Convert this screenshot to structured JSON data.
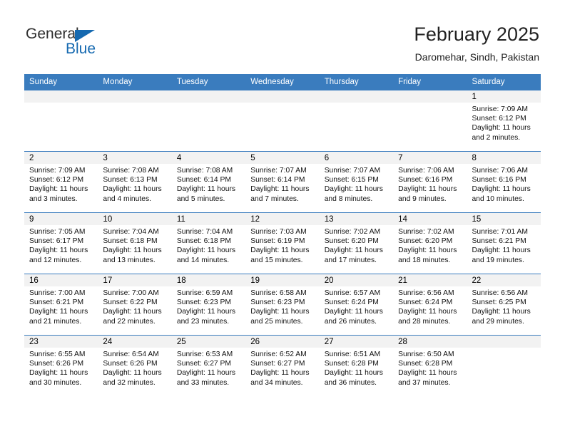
{
  "brand": {
    "name_part1": "General",
    "name_part2": "Blue",
    "triangle_icon": "triangle-icon",
    "accent_color": "#1569b0"
  },
  "header": {
    "title": "February 2025",
    "subtitle": "Daromehar, Sindh, Pakistan"
  },
  "theme": {
    "header_row_color": "#3a7cbe",
    "day_strip_color": "#f2f2f2",
    "grid_line_color": "#3a7cbe"
  },
  "weekday_headers": [
    "Sunday",
    "Monday",
    "Tuesday",
    "Wednesday",
    "Thursday",
    "Friday",
    "Saturday"
  ],
  "weeks": [
    [
      {
        "day": "",
        "sunrise": "",
        "sunset": "",
        "daylight": ""
      },
      {
        "day": "",
        "sunrise": "",
        "sunset": "",
        "daylight": ""
      },
      {
        "day": "",
        "sunrise": "",
        "sunset": "",
        "daylight": ""
      },
      {
        "day": "",
        "sunrise": "",
        "sunset": "",
        "daylight": ""
      },
      {
        "day": "",
        "sunrise": "",
        "sunset": "",
        "daylight": ""
      },
      {
        "day": "",
        "sunrise": "",
        "sunset": "",
        "daylight": ""
      },
      {
        "day": "1",
        "sunrise": "Sunrise: 7:09 AM",
        "sunset": "Sunset: 6:12 PM",
        "daylight": "Daylight: 11 hours and 2 minutes."
      }
    ],
    [
      {
        "day": "2",
        "sunrise": "Sunrise: 7:09 AM",
        "sunset": "Sunset: 6:12 PM",
        "daylight": "Daylight: 11 hours and 3 minutes."
      },
      {
        "day": "3",
        "sunrise": "Sunrise: 7:08 AM",
        "sunset": "Sunset: 6:13 PM",
        "daylight": "Daylight: 11 hours and 4 minutes."
      },
      {
        "day": "4",
        "sunrise": "Sunrise: 7:08 AM",
        "sunset": "Sunset: 6:14 PM",
        "daylight": "Daylight: 11 hours and 5 minutes."
      },
      {
        "day": "5",
        "sunrise": "Sunrise: 7:07 AM",
        "sunset": "Sunset: 6:14 PM",
        "daylight": "Daylight: 11 hours and 7 minutes."
      },
      {
        "day": "6",
        "sunrise": "Sunrise: 7:07 AM",
        "sunset": "Sunset: 6:15 PM",
        "daylight": "Daylight: 11 hours and 8 minutes."
      },
      {
        "day": "7",
        "sunrise": "Sunrise: 7:06 AM",
        "sunset": "Sunset: 6:16 PM",
        "daylight": "Daylight: 11 hours and 9 minutes."
      },
      {
        "day": "8",
        "sunrise": "Sunrise: 7:06 AM",
        "sunset": "Sunset: 6:16 PM",
        "daylight": "Daylight: 11 hours and 10 minutes."
      }
    ],
    [
      {
        "day": "9",
        "sunrise": "Sunrise: 7:05 AM",
        "sunset": "Sunset: 6:17 PM",
        "daylight": "Daylight: 11 hours and 12 minutes."
      },
      {
        "day": "10",
        "sunrise": "Sunrise: 7:04 AM",
        "sunset": "Sunset: 6:18 PM",
        "daylight": "Daylight: 11 hours and 13 minutes."
      },
      {
        "day": "11",
        "sunrise": "Sunrise: 7:04 AM",
        "sunset": "Sunset: 6:18 PM",
        "daylight": "Daylight: 11 hours and 14 minutes."
      },
      {
        "day": "12",
        "sunrise": "Sunrise: 7:03 AM",
        "sunset": "Sunset: 6:19 PM",
        "daylight": "Daylight: 11 hours and 15 minutes."
      },
      {
        "day": "13",
        "sunrise": "Sunrise: 7:02 AM",
        "sunset": "Sunset: 6:20 PM",
        "daylight": "Daylight: 11 hours and 17 minutes."
      },
      {
        "day": "14",
        "sunrise": "Sunrise: 7:02 AM",
        "sunset": "Sunset: 6:20 PM",
        "daylight": "Daylight: 11 hours and 18 minutes."
      },
      {
        "day": "15",
        "sunrise": "Sunrise: 7:01 AM",
        "sunset": "Sunset: 6:21 PM",
        "daylight": "Daylight: 11 hours and 19 minutes."
      }
    ],
    [
      {
        "day": "16",
        "sunrise": "Sunrise: 7:00 AM",
        "sunset": "Sunset: 6:21 PM",
        "daylight": "Daylight: 11 hours and 21 minutes."
      },
      {
        "day": "17",
        "sunrise": "Sunrise: 7:00 AM",
        "sunset": "Sunset: 6:22 PM",
        "daylight": "Daylight: 11 hours and 22 minutes."
      },
      {
        "day": "18",
        "sunrise": "Sunrise: 6:59 AM",
        "sunset": "Sunset: 6:23 PM",
        "daylight": "Daylight: 11 hours and 23 minutes."
      },
      {
        "day": "19",
        "sunrise": "Sunrise: 6:58 AM",
        "sunset": "Sunset: 6:23 PM",
        "daylight": "Daylight: 11 hours and 25 minutes."
      },
      {
        "day": "20",
        "sunrise": "Sunrise: 6:57 AM",
        "sunset": "Sunset: 6:24 PM",
        "daylight": "Daylight: 11 hours and 26 minutes."
      },
      {
        "day": "21",
        "sunrise": "Sunrise: 6:56 AM",
        "sunset": "Sunset: 6:24 PM",
        "daylight": "Daylight: 11 hours and 28 minutes."
      },
      {
        "day": "22",
        "sunrise": "Sunrise: 6:56 AM",
        "sunset": "Sunset: 6:25 PM",
        "daylight": "Daylight: 11 hours and 29 minutes."
      }
    ],
    [
      {
        "day": "23",
        "sunrise": "Sunrise: 6:55 AM",
        "sunset": "Sunset: 6:26 PM",
        "daylight": "Daylight: 11 hours and 30 minutes."
      },
      {
        "day": "24",
        "sunrise": "Sunrise: 6:54 AM",
        "sunset": "Sunset: 6:26 PM",
        "daylight": "Daylight: 11 hours and 32 minutes."
      },
      {
        "day": "25",
        "sunrise": "Sunrise: 6:53 AM",
        "sunset": "Sunset: 6:27 PM",
        "daylight": "Daylight: 11 hours and 33 minutes."
      },
      {
        "day": "26",
        "sunrise": "Sunrise: 6:52 AM",
        "sunset": "Sunset: 6:27 PM",
        "daylight": "Daylight: 11 hours and 34 minutes."
      },
      {
        "day": "27",
        "sunrise": "Sunrise: 6:51 AM",
        "sunset": "Sunset: 6:28 PM",
        "daylight": "Daylight: 11 hours and 36 minutes."
      },
      {
        "day": "28",
        "sunrise": "Sunrise: 6:50 AM",
        "sunset": "Sunset: 6:28 PM",
        "daylight": "Daylight: 11 hours and 37 minutes."
      },
      {
        "day": "",
        "sunrise": "",
        "sunset": "",
        "daylight": ""
      }
    ]
  ]
}
